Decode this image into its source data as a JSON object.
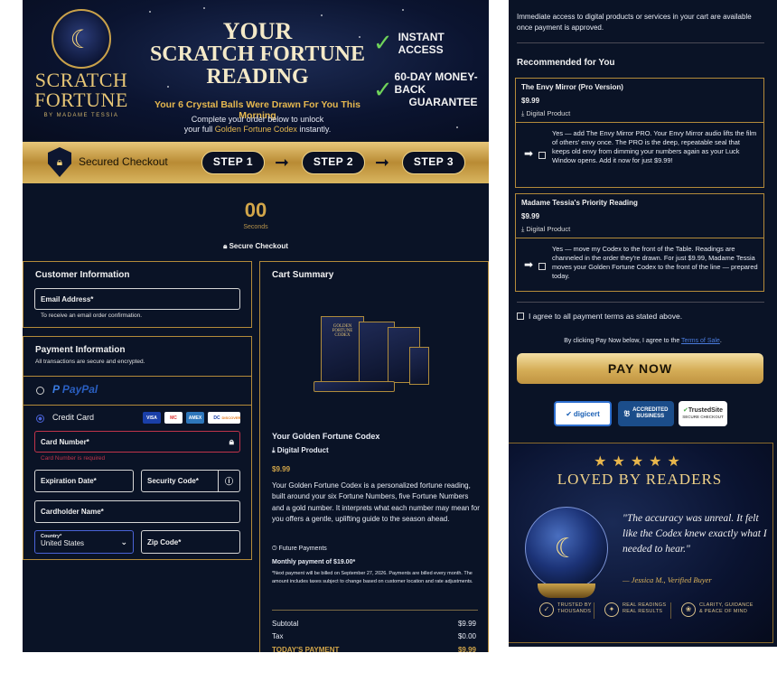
{
  "hero": {
    "logo_line1": "SCRATCH",
    "logo_line2": "FORTUNE",
    "logo_line3": "BY MADAME TESSIA",
    "title_line1": "YOUR",
    "title_line2": "SCRATCH FORTUNE",
    "title_line3": "READING",
    "subtitle": "Your 6 Crystal Balls Were Drawn For You This Morning",
    "note_line1": "Complete your order below to unlock",
    "note_line2_pre": "your full ",
    "note_line2_gold": "Golden Fortune Codex",
    "note_line2_post": " instantly.",
    "feature1": "INSTANT ACCESS",
    "feature2_line1": "60-DAY MONEY-BACK",
    "feature2_line2": "GUARANTEE"
  },
  "steps": {
    "secured_label": "Secured Checkout",
    "step1": "STEP 1",
    "step2": "STEP 2",
    "step3": "STEP 3"
  },
  "timer": {
    "value": "00",
    "unit": "Seconds",
    "secure_checkout": "Secure Checkout"
  },
  "customer": {
    "title": "Customer Information",
    "email_label": "Email Address*",
    "email_hint": "To receive an email order confirmation."
  },
  "payment": {
    "title": "Payment Information",
    "subtitle": "All transactions are secure and encrypted.",
    "paypal_label": "PayPal",
    "credit_card_label": "Credit Card",
    "card_number_label": "Card Number*",
    "card_number_error": "Card Number is required",
    "expiration_label": "Expiration Date*",
    "security_label": "Security Code*",
    "cardholder_label": "Cardholder Name*",
    "country_label": "Country*",
    "country_value": "United States",
    "zip_label": "Zip Code*",
    "cards": [
      "VISA",
      "MC",
      "AMEX",
      "DC",
      "DISCOVER"
    ]
  },
  "cart": {
    "title": "Cart Summary",
    "image_line1": "GOLDEN",
    "image_line2": "FORTUNE",
    "image_line3": "CODEX",
    "product_name": "Your Golden Fortune Codex",
    "product_type": "Digital Product",
    "price": "$9.99",
    "description": "Your Golden Fortune Codex is a personalized fortune reading, built around your six Fortune Numbers, five Fortune Numbers and a gold number. It interprets what each number may mean for you offers a gentle, uplifting guide to the season ahead.",
    "future_label": "Future Payments",
    "monthly": "Monthly payment of $19.00*",
    "footnote": "*Next payment will be billed on September 27, 2026. Payments are billed every month. The amount includes taxes subject to change based on customer location and rate adjustments.",
    "subtotal_label": "Subtotal",
    "subtotal_value": "$9.99",
    "tax_label": "Tax",
    "tax_value": "$0.00",
    "today_label": "TODAY'S PAYMENT",
    "today_value": "$9.99"
  },
  "right": {
    "access_note": "Immediate access to digital products or services in your cart are available once payment is approved.",
    "recommended_title": "Recommended for You",
    "upsells": [
      {
        "title": "The Envy Mirror (Pro Version)",
        "price": "$9.99",
        "type": "Digital Product",
        "desc": "Yes — add The Envy Mirror PRO. Your Envy Mirror audio lifts the film of others' envy once. The PRO is the deep, repeatable seal that keeps old envy from dimming your numbers again as your Luck Window opens. Add it now for just $9.99!"
      },
      {
        "title": "Madame Tessia's Priority Reading",
        "price": "$9.99",
        "type": "Digital Product",
        "desc": "Yes — move my Codex to the front of the Table. Readings are channeled in the order they're drawn. For just $9.99, Madame Tessia moves your Golden Fortune Codex to the front of the line — prepared today."
      }
    ],
    "agree_label": "I agree to all payment terms as stated above.",
    "terms_pre": "By clicking Pay Now below, I agree to the ",
    "terms_link": "Terms of Sale",
    "terms_post": ".",
    "pay_now": "PAY NOW",
    "badge1": "digicert",
    "badge1_sub": "SECURED",
    "badge2_line1": "ACCREDITED",
    "badge2_line2": "BUSINESS",
    "badge2_sub": "Click for Profile",
    "badge3": "TrustedSite",
    "badge3_sub": "SECURE CHECKOUT"
  },
  "testimonial": {
    "stars": "★★★★★",
    "heading": "LOVED BY READERS",
    "quote": "\"The accuracy was unreal. It felt like the Codex knew exactly what I needed to hear.\"",
    "author": "— Jessica M., Verified Buyer",
    "trust1_line1": "TRUSTED BY",
    "trust1_line2": "THOUSANDS",
    "trust2_line1": "REAL READINGS",
    "trust2_line2": "REAL RESULTS",
    "trust3_line1": "CLARITY, GUIDANCE",
    "trust3_line2": "& PEACE OF MIND"
  },
  "colors": {
    "background": "#0a1326",
    "gold": "#d2a64a",
    "border": "#b48b3a",
    "error": "#c0344a",
    "paypal": "#2a5fc1"
  }
}
